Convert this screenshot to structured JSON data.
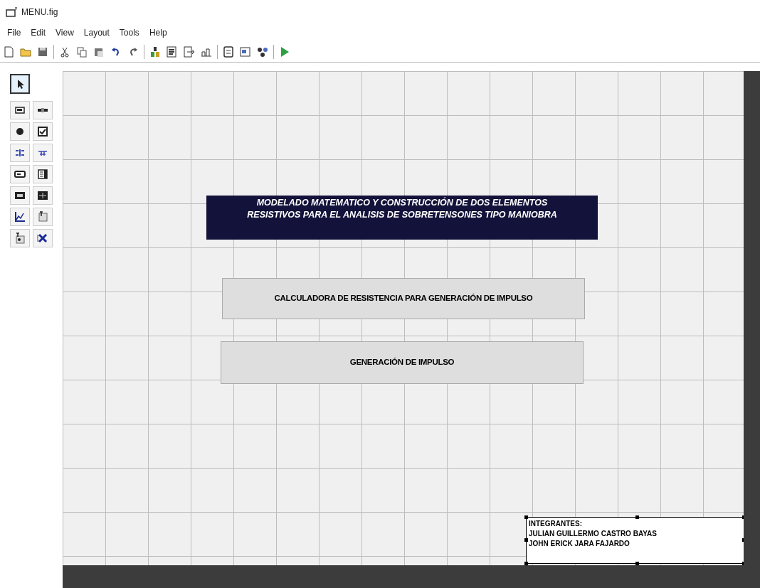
{
  "window": {
    "title": "MENU.fig"
  },
  "menu": [
    "File",
    "Edit",
    "View",
    "Layout",
    "Tools",
    "Help"
  ],
  "palette": [
    {
      "selected": true
    },
    {
      "selected": false
    },
    {
      "selected": false
    },
    {
      "selected": false
    },
    {
      "selected": false
    },
    {
      "selected": false
    },
    {
      "selected": false
    },
    {
      "selected": false
    },
    {
      "selected": false
    },
    {
      "selected": false
    },
    {
      "selected": false
    },
    {
      "selected": false
    },
    {
      "selected": false
    },
    {
      "selected": false
    },
    {
      "selected": false
    }
  ],
  "components": [
    {
      "kind": "static_text",
      "lines": [
        "MODELADO MATEMATICO Y CONSTRUCCIÓN DE DOS ELEMENTOS",
        "RESISTIVOS PARA EL ANALISIS DE SOBRETENSONES TIPO MANIOBRA"
      ],
      "selected": false
    },
    {
      "kind": "button",
      "lines": [
        "CALCULADORA DE RESISTENCIA PARA GENERACIÓN DE IMPULSO"
      ],
      "selected": false
    },
    {
      "kind": "button",
      "lines": [
        "GENERACIÓN DE IMPULSO"
      ],
      "selected": false
    },
    {
      "kind": "label",
      "lines": [
        "INTEGRANTES:",
        "JULIAN GUILLERMO CASTRO BAYAS",
        "JOHN ERICK JARA FAJARDO"
      ],
      "selected": true
    }
  ]
}
